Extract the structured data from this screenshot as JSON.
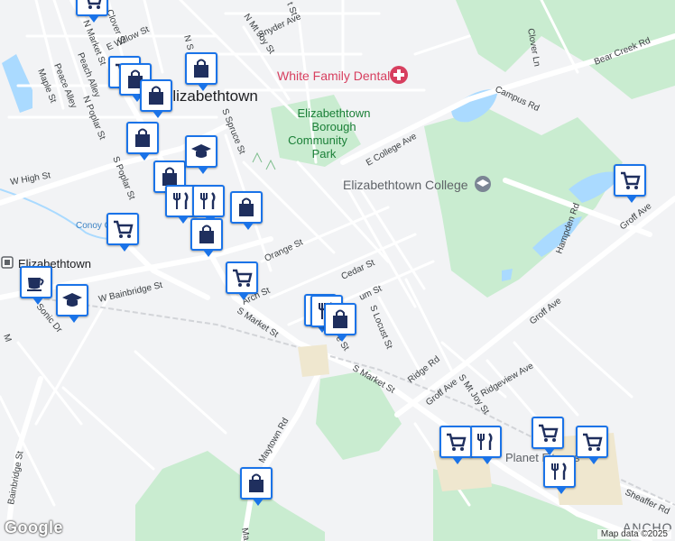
{
  "map": {
    "attribution": "Map data ©2025",
    "logo": "Google",
    "places": {
      "town": "Elizabethtown",
      "town_west": "Elizabethtown",
      "dental": "White Family Dental",
      "park": "Elizabethtown Borough Community Park",
      "college": "Elizabethtown College",
      "planet": "Planet Fitness",
      "anchor": "ANCHO"
    },
    "streets": {
      "w_high": "W High St",
      "w_bainbridge": "W Bainbridge St",
      "s_market": "S Market St",
      "s_market_2": "S Market St",
      "maytown": "Maytown Rd",
      "bainbridge_st": "Bainbridge St",
      "orange": "Orange St",
      "cedar": "Cedar St",
      "arch": "Arch St",
      "s_locust": "S Locust St",
      "groff_1": "Groff Ave",
      "groff_2": "Groff Ave",
      "groff_3": "Groff Ave",
      "ridge": "Ridge Rd",
      "ridgeview": "Ridgeview Ave",
      "s_mt_joy": "S Mt Joy St",
      "e_college": "E College Ave",
      "campus": "Campus Rd",
      "bear_creek": "Bear Creek Rd",
      "clover": "Clover Ln",
      "hampden": "Hampden Rd",
      "sheaffer": "Sheaffer Rd",
      "snyder": "Snyder Ave",
      "n_mt_joy": "N Mt Joy St",
      "n_market": "N Market St",
      "peach": "Peach Alley",
      "peace": "Peace Alley",
      "maple": "Maple St",
      "n_poplar": "N Poplar St",
      "s_poplar": "S Poplar St",
      "s_spruce": "S Spruce St",
      "e_willow": "E Willow St",
      "clover_st": "Clover St",
      "conoy": "Conoy Creek",
      "sonic": "Sonic Dr",
      "plum_frag": "um St",
      "e_frag": "e St",
      "n_s_frag": "N S",
      "t_frag": "t St",
      "m_frag": "M",
      "ma_frag": "Ma",
      "k_frag": "k"
    },
    "markers": [
      {
        "kind": "shopping-cart",
        "name": "marker-grocery"
      },
      {
        "kind": "shopping-cart",
        "name": "marker-grocery"
      },
      {
        "kind": "shopping-cart",
        "name": "marker-grocery"
      },
      {
        "kind": "shopping-bag",
        "name": "marker-shopping"
      },
      {
        "kind": "shopping-bag",
        "name": "marker-shopping"
      },
      {
        "kind": "shopping-bag",
        "name": "marker-shopping"
      },
      {
        "kind": "shopping-bag",
        "name": "marker-shopping"
      },
      {
        "kind": "shopping-bag",
        "name": "marker-shopping"
      },
      {
        "kind": "restaurant",
        "name": "marker-restaurant"
      },
      {
        "kind": "restaurant",
        "name": "marker-restaurant"
      },
      {
        "kind": "education",
        "name": "marker-school"
      },
      {
        "kind": "shopping-bag",
        "name": "marker-shopping"
      },
      {
        "kind": "shopping-bag",
        "name": "marker-shopping"
      },
      {
        "kind": "shopping-cart",
        "name": "marker-grocery"
      },
      {
        "kind": "shopping-cart",
        "name": "marker-grocery"
      },
      {
        "kind": "cafe",
        "name": "marker-cafe"
      },
      {
        "kind": "education",
        "name": "marker-school"
      },
      {
        "kind": "restaurant",
        "name": "marker-restaurant"
      },
      {
        "kind": "shopping-bag",
        "name": "marker-shopping"
      },
      {
        "kind": "shopping-cart",
        "name": "marker-grocery"
      },
      {
        "kind": "shopping-cart",
        "name": "marker-grocery"
      },
      {
        "kind": "restaurant",
        "name": "marker-restaurant"
      },
      {
        "kind": "shopping-cart",
        "name": "marker-grocery"
      },
      {
        "kind": "shopping-cart",
        "name": "marker-grocery"
      },
      {
        "kind": "restaurant",
        "name": "marker-restaurant"
      },
      {
        "kind": "shopping-bag",
        "name": "marker-shopping"
      }
    ],
    "colors": {
      "marker_border": "#1a73e8",
      "marker_icon": "#1f2f5e",
      "park_green": "#c9ecd0",
      "water": "#aadaff",
      "road": "#ffffff",
      "poi_pink": "#d73f5f"
    }
  }
}
